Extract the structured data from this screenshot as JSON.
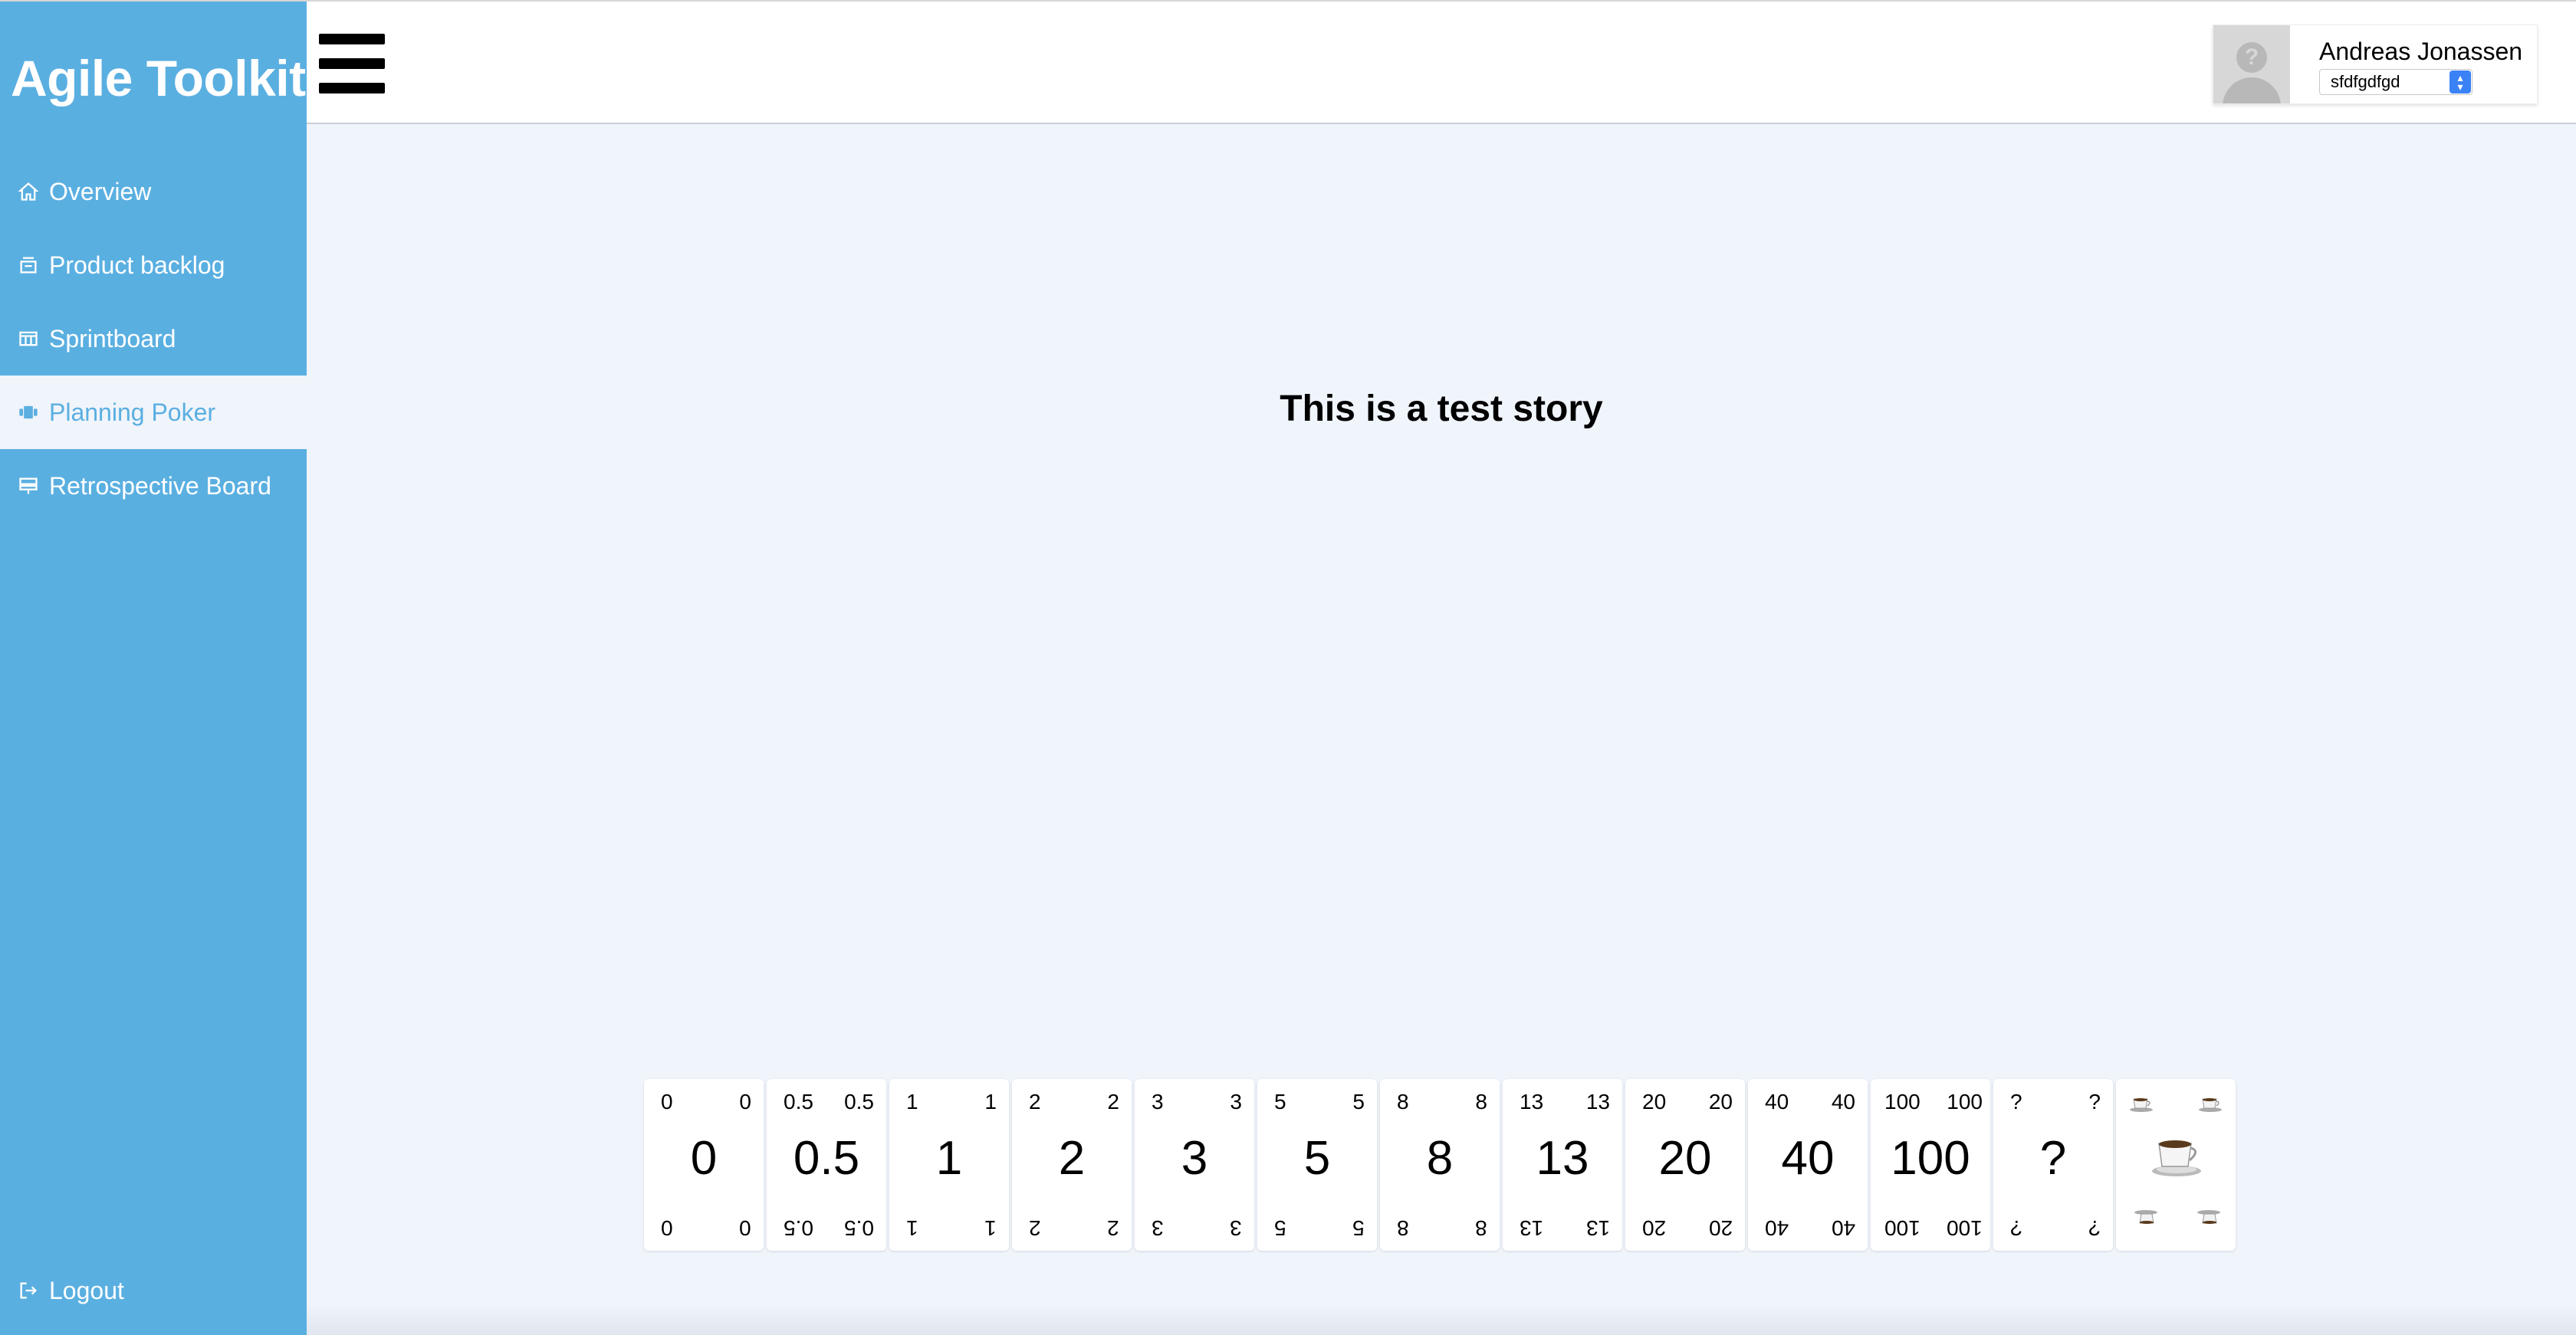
{
  "app": {
    "brand": "Agile Toolkit"
  },
  "sidebar": {
    "items": [
      {
        "label": "Overview",
        "icon": "home-icon",
        "active": false
      },
      {
        "label": "Product backlog",
        "icon": "backlog-icon",
        "active": false
      },
      {
        "label": "Sprintboard",
        "icon": "board-icon",
        "active": false
      },
      {
        "label": "Planning Poker",
        "icon": "cards-icon",
        "active": true
      },
      {
        "label": "Retrospective Board",
        "icon": "retro-icon",
        "active": false
      }
    ],
    "logout_label": "Logout"
  },
  "header": {
    "user_name": "Andreas Jonassen",
    "team_selected": "sfdfgdfgd"
  },
  "main": {
    "story_title": "This is a test story"
  },
  "cards": [
    {
      "value": "0"
    },
    {
      "value": "0.5"
    },
    {
      "value": "1"
    },
    {
      "value": "2"
    },
    {
      "value": "3"
    },
    {
      "value": "5"
    },
    {
      "value": "8"
    },
    {
      "value": "13"
    },
    {
      "value": "20"
    },
    {
      "value": "40"
    },
    {
      "value": "100"
    },
    {
      "value": "?"
    },
    {
      "value": "",
      "icon": "coffee-icon"
    }
  ],
  "colors": {
    "sidebar": "#5aafe1",
    "background": "#f0f4fb",
    "select_accent": "#3b82f6"
  }
}
